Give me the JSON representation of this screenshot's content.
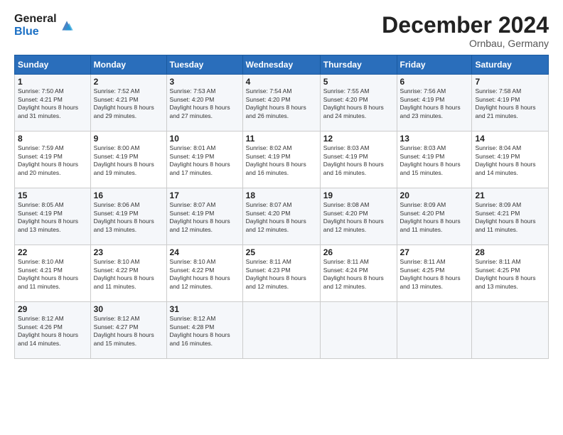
{
  "logo": {
    "general": "General",
    "blue": "Blue"
  },
  "title": {
    "month_year": "December 2024",
    "location": "Ornbau, Germany"
  },
  "weekdays": [
    "Sunday",
    "Monday",
    "Tuesday",
    "Wednesday",
    "Thursday",
    "Friday",
    "Saturday"
  ],
  "weeks": [
    [
      {
        "day": "1",
        "sunrise": "7:50 AM",
        "sunset": "4:21 PM",
        "daylight": "8 hours and 31 minutes."
      },
      {
        "day": "2",
        "sunrise": "7:52 AM",
        "sunset": "4:21 PM",
        "daylight": "8 hours and 29 minutes."
      },
      {
        "day": "3",
        "sunrise": "7:53 AM",
        "sunset": "4:20 PM",
        "daylight": "8 hours and 27 minutes."
      },
      {
        "day": "4",
        "sunrise": "7:54 AM",
        "sunset": "4:20 PM",
        "daylight": "8 hours and 26 minutes."
      },
      {
        "day": "5",
        "sunrise": "7:55 AM",
        "sunset": "4:20 PM",
        "daylight": "8 hours and 24 minutes."
      },
      {
        "day": "6",
        "sunrise": "7:56 AM",
        "sunset": "4:19 PM",
        "daylight": "8 hours and 23 minutes."
      },
      {
        "day": "7",
        "sunrise": "7:58 AM",
        "sunset": "4:19 PM",
        "daylight": "8 hours and 21 minutes."
      }
    ],
    [
      {
        "day": "8",
        "sunrise": "7:59 AM",
        "sunset": "4:19 PM",
        "daylight": "8 hours and 20 minutes."
      },
      {
        "day": "9",
        "sunrise": "8:00 AM",
        "sunset": "4:19 PM",
        "daylight": "8 hours and 19 minutes."
      },
      {
        "day": "10",
        "sunrise": "8:01 AM",
        "sunset": "4:19 PM",
        "daylight": "8 hours and 17 minutes."
      },
      {
        "day": "11",
        "sunrise": "8:02 AM",
        "sunset": "4:19 PM",
        "daylight": "8 hours and 16 minutes."
      },
      {
        "day": "12",
        "sunrise": "8:03 AM",
        "sunset": "4:19 PM",
        "daylight": "8 hours and 16 minutes."
      },
      {
        "day": "13",
        "sunrise": "8:03 AM",
        "sunset": "4:19 PM",
        "daylight": "8 hours and 15 minutes."
      },
      {
        "day": "14",
        "sunrise": "8:04 AM",
        "sunset": "4:19 PM",
        "daylight": "8 hours and 14 minutes."
      }
    ],
    [
      {
        "day": "15",
        "sunrise": "8:05 AM",
        "sunset": "4:19 PM",
        "daylight": "8 hours and 13 minutes."
      },
      {
        "day": "16",
        "sunrise": "8:06 AM",
        "sunset": "4:19 PM",
        "daylight": "8 hours and 13 minutes."
      },
      {
        "day": "17",
        "sunrise": "8:07 AM",
        "sunset": "4:19 PM",
        "daylight": "8 hours and 12 minutes."
      },
      {
        "day": "18",
        "sunrise": "8:07 AM",
        "sunset": "4:20 PM",
        "daylight": "8 hours and 12 minutes."
      },
      {
        "day": "19",
        "sunrise": "8:08 AM",
        "sunset": "4:20 PM",
        "daylight": "8 hours and 12 minutes."
      },
      {
        "day": "20",
        "sunrise": "8:09 AM",
        "sunset": "4:20 PM",
        "daylight": "8 hours and 11 minutes."
      },
      {
        "day": "21",
        "sunrise": "8:09 AM",
        "sunset": "4:21 PM",
        "daylight": "8 hours and 11 minutes."
      }
    ],
    [
      {
        "day": "22",
        "sunrise": "8:10 AM",
        "sunset": "4:21 PM",
        "daylight": "8 hours and 11 minutes."
      },
      {
        "day": "23",
        "sunrise": "8:10 AM",
        "sunset": "4:22 PM",
        "daylight": "8 hours and 11 minutes."
      },
      {
        "day": "24",
        "sunrise": "8:10 AM",
        "sunset": "4:22 PM",
        "daylight": "8 hours and 12 minutes."
      },
      {
        "day": "25",
        "sunrise": "8:11 AM",
        "sunset": "4:23 PM",
        "daylight": "8 hours and 12 minutes."
      },
      {
        "day": "26",
        "sunrise": "8:11 AM",
        "sunset": "4:24 PM",
        "daylight": "8 hours and 12 minutes."
      },
      {
        "day": "27",
        "sunrise": "8:11 AM",
        "sunset": "4:25 PM",
        "daylight": "8 hours and 13 minutes."
      },
      {
        "day": "28",
        "sunrise": "8:11 AM",
        "sunset": "4:25 PM",
        "daylight": "8 hours and 13 minutes."
      }
    ],
    [
      {
        "day": "29",
        "sunrise": "8:12 AM",
        "sunset": "4:26 PM",
        "daylight": "8 hours and 14 minutes."
      },
      {
        "day": "30",
        "sunrise": "8:12 AM",
        "sunset": "4:27 PM",
        "daylight": "8 hours and 15 minutes."
      },
      {
        "day": "31",
        "sunrise": "8:12 AM",
        "sunset": "4:28 PM",
        "daylight": "8 hours and 16 minutes."
      },
      null,
      null,
      null,
      null
    ]
  ]
}
